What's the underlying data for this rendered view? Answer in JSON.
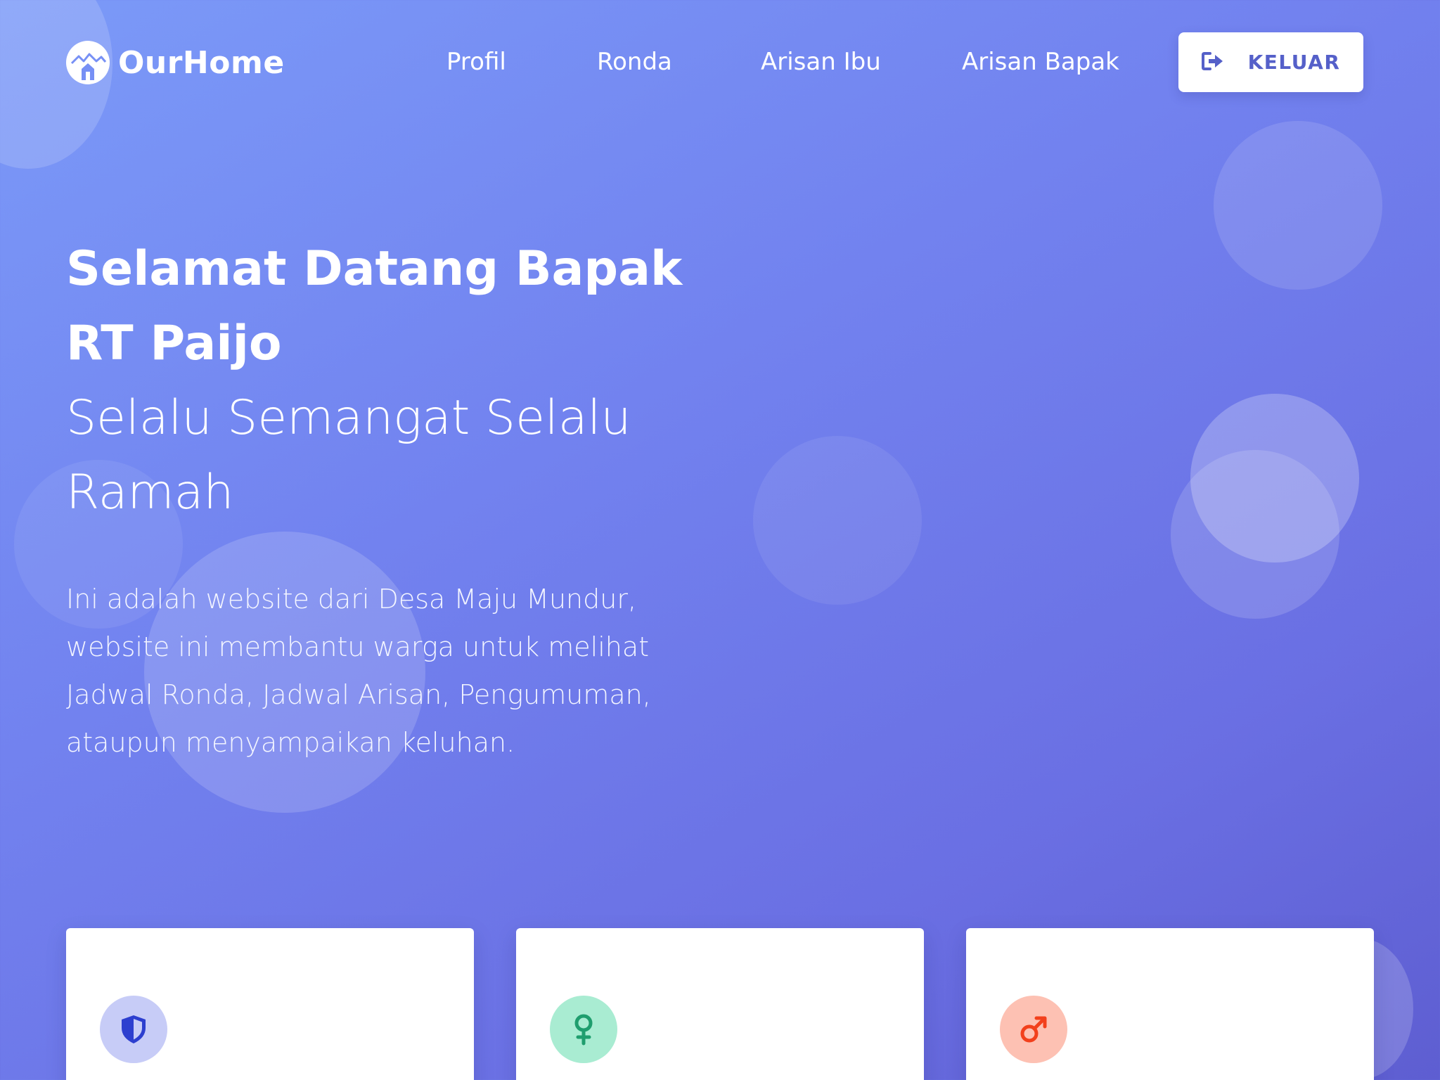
{
  "brand": {
    "name": "OurHome",
    "logo_icon": "house-mountain-icon"
  },
  "nav": {
    "links": [
      {
        "label": "Profil"
      },
      {
        "label": "Ronda"
      },
      {
        "label": "Arisan Ibu"
      },
      {
        "label": "Arisan Bapak"
      }
    ],
    "logout": {
      "label": "KELUAR",
      "icon": "sign-out-icon"
    }
  },
  "hero": {
    "title": "Selamat Datang Bapak RT Paijo",
    "subtitle": "Selalu Semangat Selalu Ramah",
    "description": "Ini adalah website dari Desa Maju Mundur, website ini membantu warga untuk melihat Jadwal Ronda, Jadwal Arisan, Pengumuman, ataupun menyampaikan keluhan."
  },
  "cards": [
    {
      "icon": "shield-icon",
      "icon_color": "#2d3fcf",
      "icon_bg": "#c7ccf7"
    },
    {
      "icon": "female-symbol-icon",
      "icon_color": "#1f9e6e",
      "icon_bg": "#a9ecd2"
    },
    {
      "icon": "male-symbol-icon",
      "icon_color": "#f2401c",
      "icon_bg": "#fdc1b3"
    }
  ],
  "colors": {
    "accent": "#5560c9",
    "background_start": "#7b9af8",
    "background_end": "#5e5ed1"
  }
}
